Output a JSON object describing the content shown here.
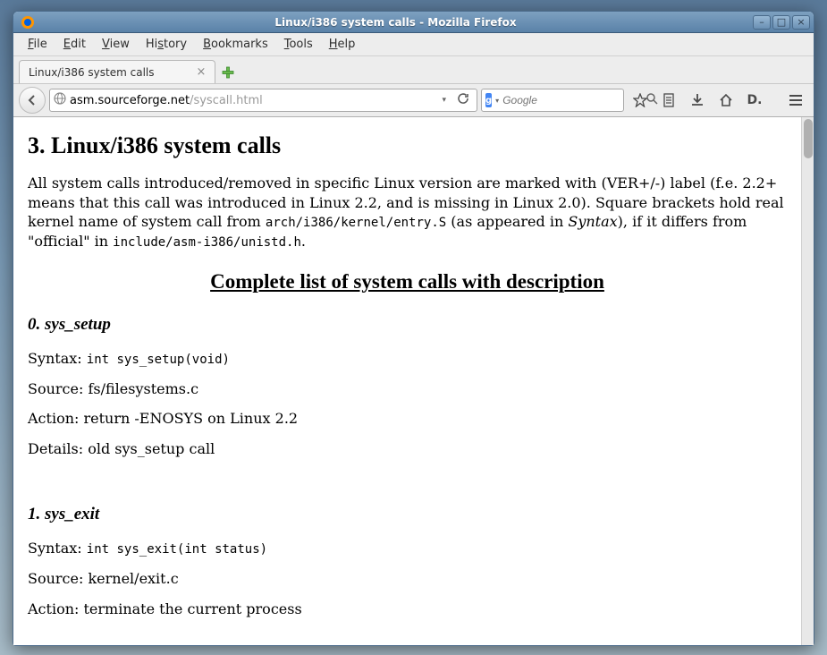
{
  "window": {
    "title": "Linux/i386 system calls - Mozilla Firefox"
  },
  "menubar": {
    "items": [
      {
        "u": "F",
        "rest": "ile"
      },
      {
        "u": "E",
        "rest": "dit"
      },
      {
        "u": "V",
        "rest": "iew"
      },
      {
        "u": "",
        "rest": "Hi",
        "u2": "s",
        "rest2": "tory"
      },
      {
        "u": "B",
        "rest": "ookmarks"
      },
      {
        "u": "T",
        "rest": "ools"
      },
      {
        "u": "H",
        "rest": "elp"
      }
    ]
  },
  "tab": {
    "label": "Linux/i386 system calls"
  },
  "url": {
    "host": "asm.sourceforge.net",
    "path": "/syscall.html"
  },
  "search": {
    "engine_letter": "g",
    "placeholder": "Google"
  },
  "toolbar": {
    "ext_label": "D."
  },
  "page": {
    "heading": "3. Linux/i386 system calls",
    "intro_parts": {
      "p1": "All system calls introduced/removed in specific Linux version are marked with (VER+/-) label (f.e. 2.2+ means that this call was introduced in Linux 2.2, and is missing in Linux 2.0). Square brackets hold real kernel name of system call from ",
      "code1": "arch/i386/kernel/entry.S",
      "p2": " (as appeared in ",
      "em": "Syntax",
      "p3": "), if it differs from \"official\" in ",
      "code2": "include/asm-i386/unistd.h",
      "p4": "."
    },
    "subheading": "Complete list of system calls with description",
    "calls": [
      {
        "heading": "0. sys_setup",
        "syntax_label": "Syntax:",
        "syntax": "int sys_setup(void)",
        "source_label": "Source:",
        "source": "fs/filesystems.c",
        "action_label": "Action:",
        "action": "return -ENOSYS on Linux 2.2",
        "details_label": "Details:",
        "details": "old sys_setup call"
      },
      {
        "heading": "1. sys_exit",
        "syntax_label": "Syntax:",
        "syntax": "int sys_exit(int status)",
        "source_label": "Source:",
        "source": "kernel/exit.c",
        "action_label": "Action:",
        "action": "terminate the current process",
        "details_label": "",
        "details": ""
      }
    ]
  }
}
